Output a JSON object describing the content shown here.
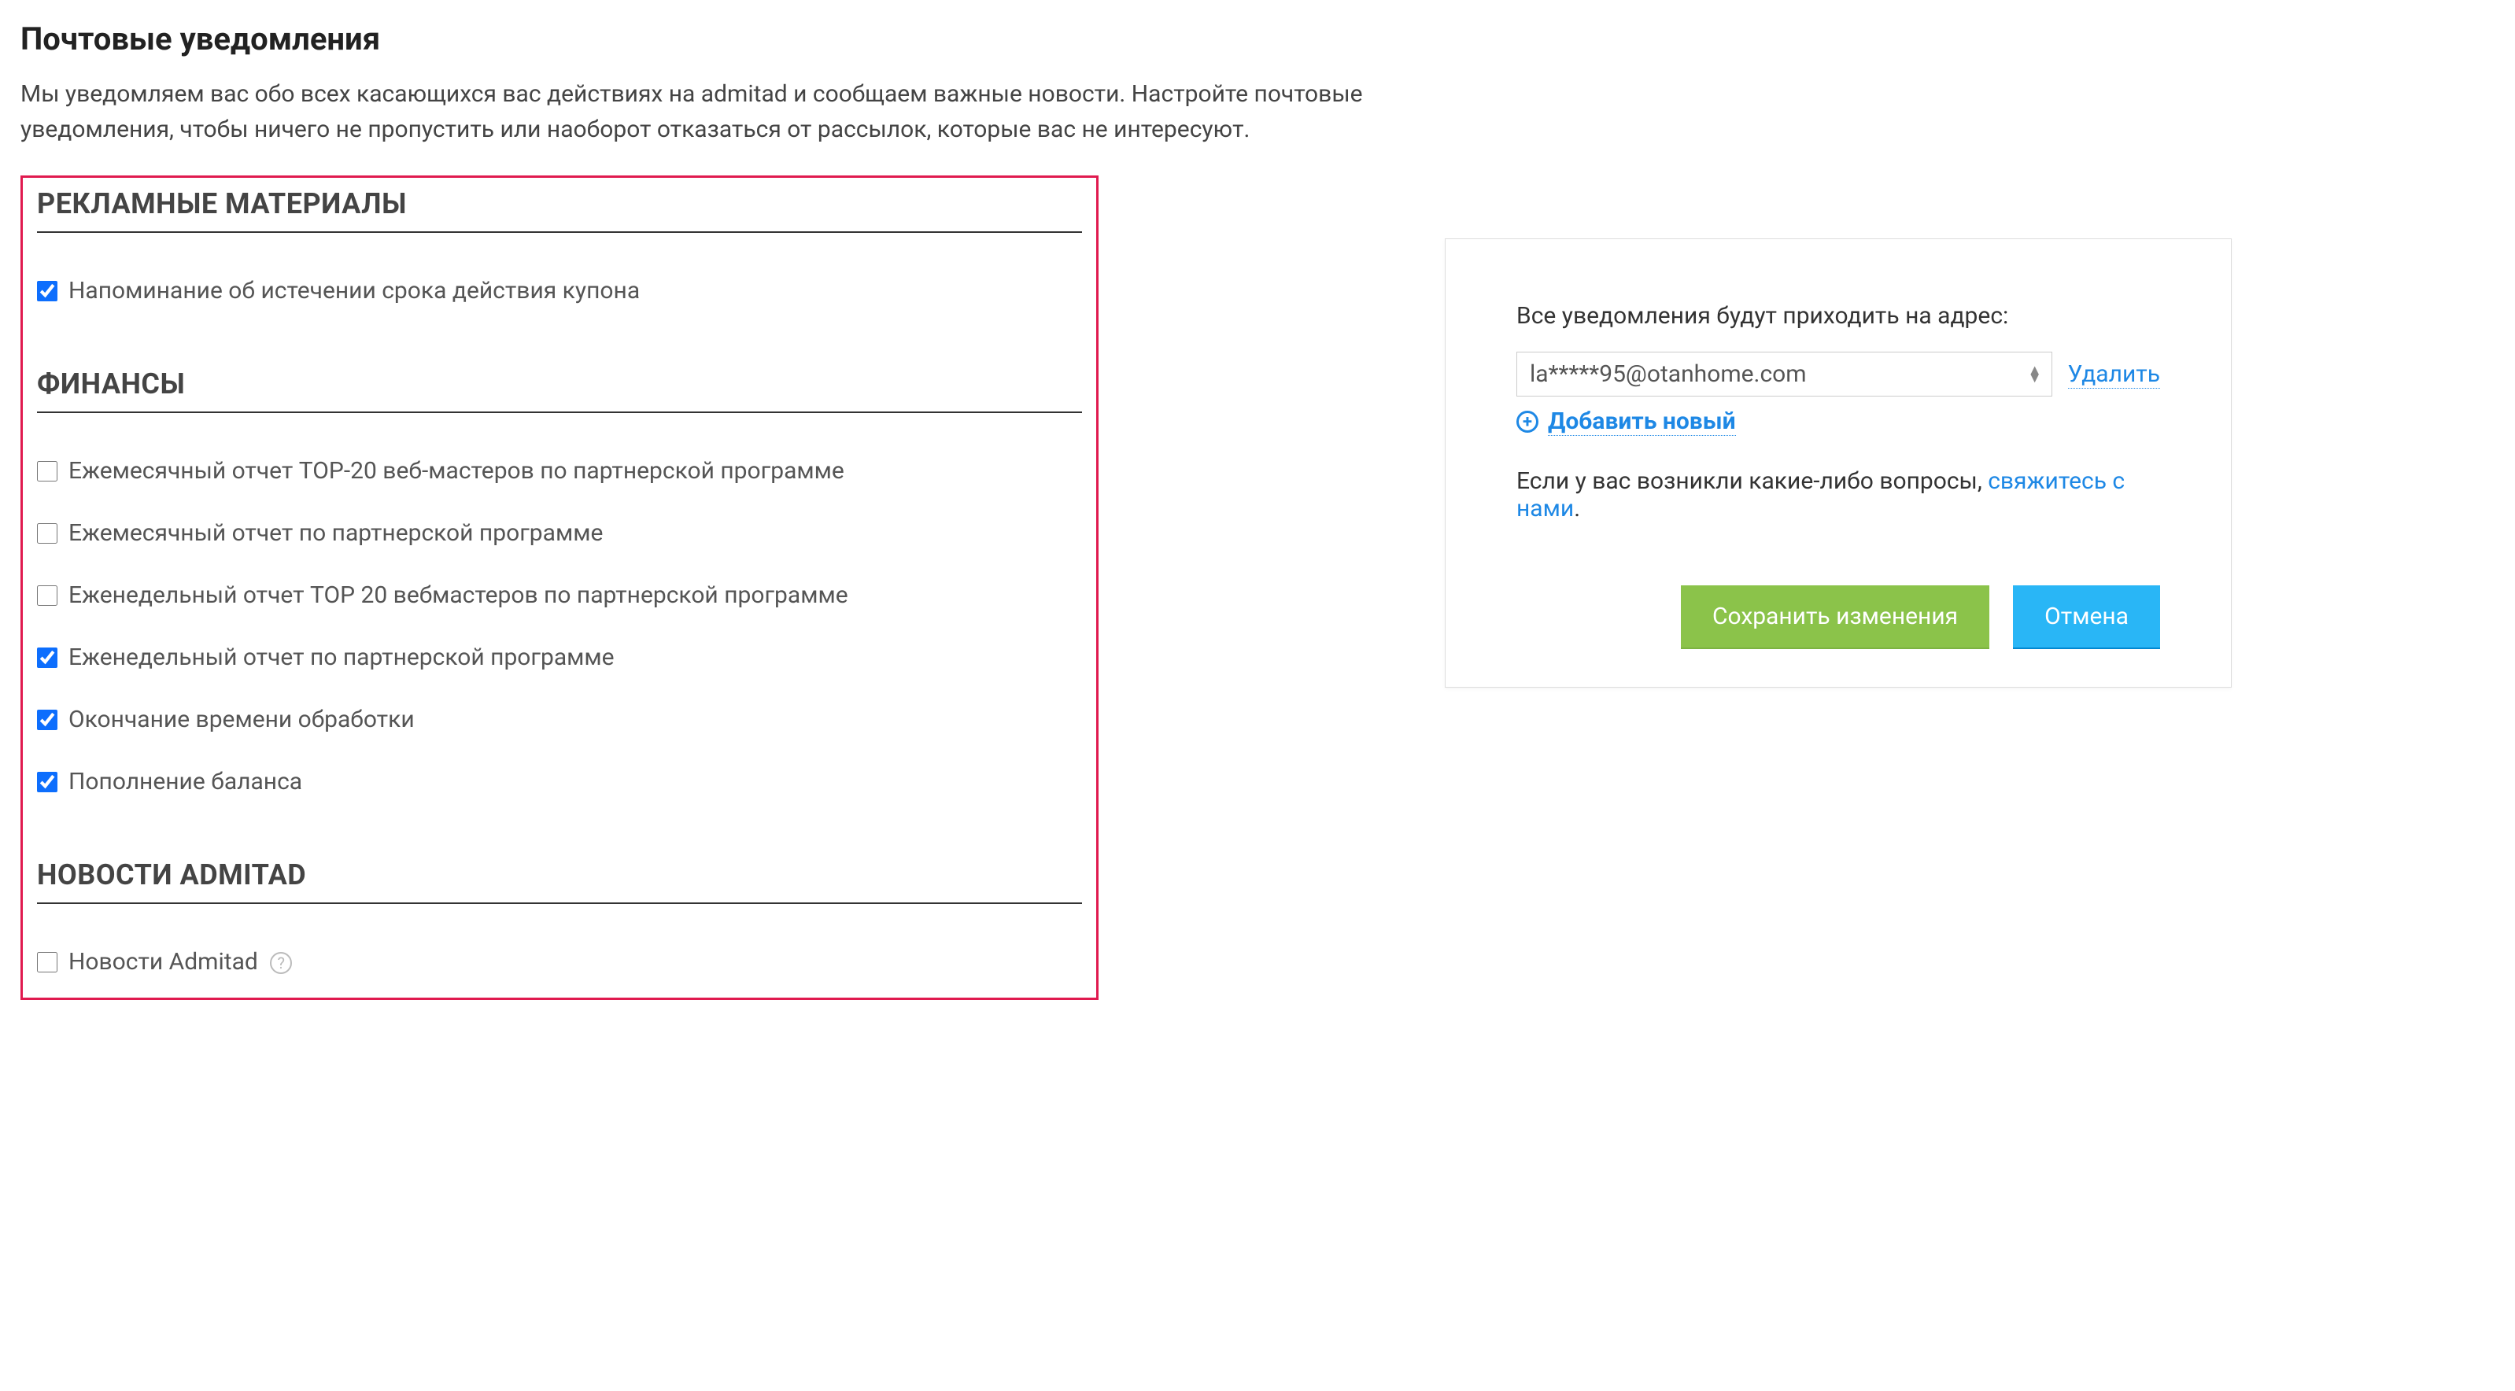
{
  "page": {
    "title": "Почтовые уведомления",
    "description": "Мы уведомляем вас обо всех касающихся вас действиях на admitad и сообщаем важные новости. Настройте почтовые уведомления, чтобы ничего не пропустить или наоборот отказаться от рассылок, которые вас не интересуют."
  },
  "sections": {
    "ad_materials": {
      "heading": "РЕКЛАМНЫЕ МАТЕРИАЛЫ",
      "items": [
        {
          "label": "Напоминание об истечении срока действия купона",
          "checked": true
        }
      ]
    },
    "finances": {
      "heading": "ФИНАНСЫ",
      "items": [
        {
          "label": "Ежемесячный отчет TOP-20 веб-мастеров по партнерской программе",
          "checked": false
        },
        {
          "label": "Ежемесячный отчет по партнерской программе",
          "checked": false
        },
        {
          "label": "Еженедельный отчет TOP 20 вебмастеров по партнерской программе",
          "checked": false
        },
        {
          "label": "Еженедельный отчет по партнерской программе",
          "checked": true
        },
        {
          "label": "Окончание времени обработки",
          "checked": true
        },
        {
          "label": "Пополнение баланса",
          "checked": true
        }
      ]
    },
    "news": {
      "heading": "НОВОСТИ ADMITAD",
      "items": [
        {
          "label": "Новости Admitad",
          "checked": false,
          "help": true
        }
      ]
    }
  },
  "sidebar": {
    "intro": "Все уведомления будут приходить на адрес:",
    "email": "la*****95@otanhome.com",
    "delete_label": "Удалить",
    "add_label": "Добавить новый",
    "questions_prefix": "Если у вас возникли какие-либо вопросы, ",
    "contact_link": "свяжитесь с нами",
    "questions_suffix": ".",
    "save_button": "Сохранить изменения",
    "cancel_button": "Отмена"
  }
}
